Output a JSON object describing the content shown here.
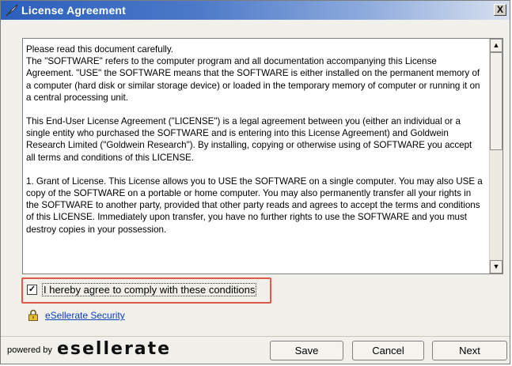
{
  "window": {
    "title": "License Agreement",
    "close_label": "X"
  },
  "license": {
    "paragraphs": [
      "Please read this document carefully.\nThe \"SOFTWARE\" refers to the computer program and all documentation accompanying this License Agreement.  \"USE\" the SOFTWARE means that the SOFTWARE is either installed on the permanent memory of a computer (hard disk or similar storage device) or loaded in the temporary memory of computer or running it on a central processing unit.",
      "This End-User License Agreement (\"LICENSE\") is a  legal agreement between you (either an individual or a single entity who purchased the SOFTWARE and is entering into this License Agreement) and Goldwein Research Limited (\"Goldwein Research\"). By installing, copying or otherwise using of SOFTWARE you accept all terms and conditions of this LICENSE.",
      "1. Grant of License.   This License allows you to USE the SOFTWARE on a single computer. You may also USE a copy of the SOFTWARE on a portable or home computer. You may also permanently transfer all your rights in the SOFTWARE to another party, provided that other party reads and agrees to accept the terms and conditions of this LICENSE. Immediately upon transfer, you have no further rights to use the SOFTWARE and you must destroy copies in your possession."
    ]
  },
  "agree": {
    "label": "I hereby agree to comply with these conditions",
    "checked": true,
    "check_glyph": "✓"
  },
  "security_link": "eSellerate Security",
  "footer": {
    "powered_by": "powered by",
    "brand": "esellerate"
  },
  "buttons": {
    "save": "Save",
    "cancel": "Cancel",
    "next": "Next"
  },
  "colors": {
    "highlight_frame": "#e05a4b",
    "link": "#0b3fbf"
  }
}
